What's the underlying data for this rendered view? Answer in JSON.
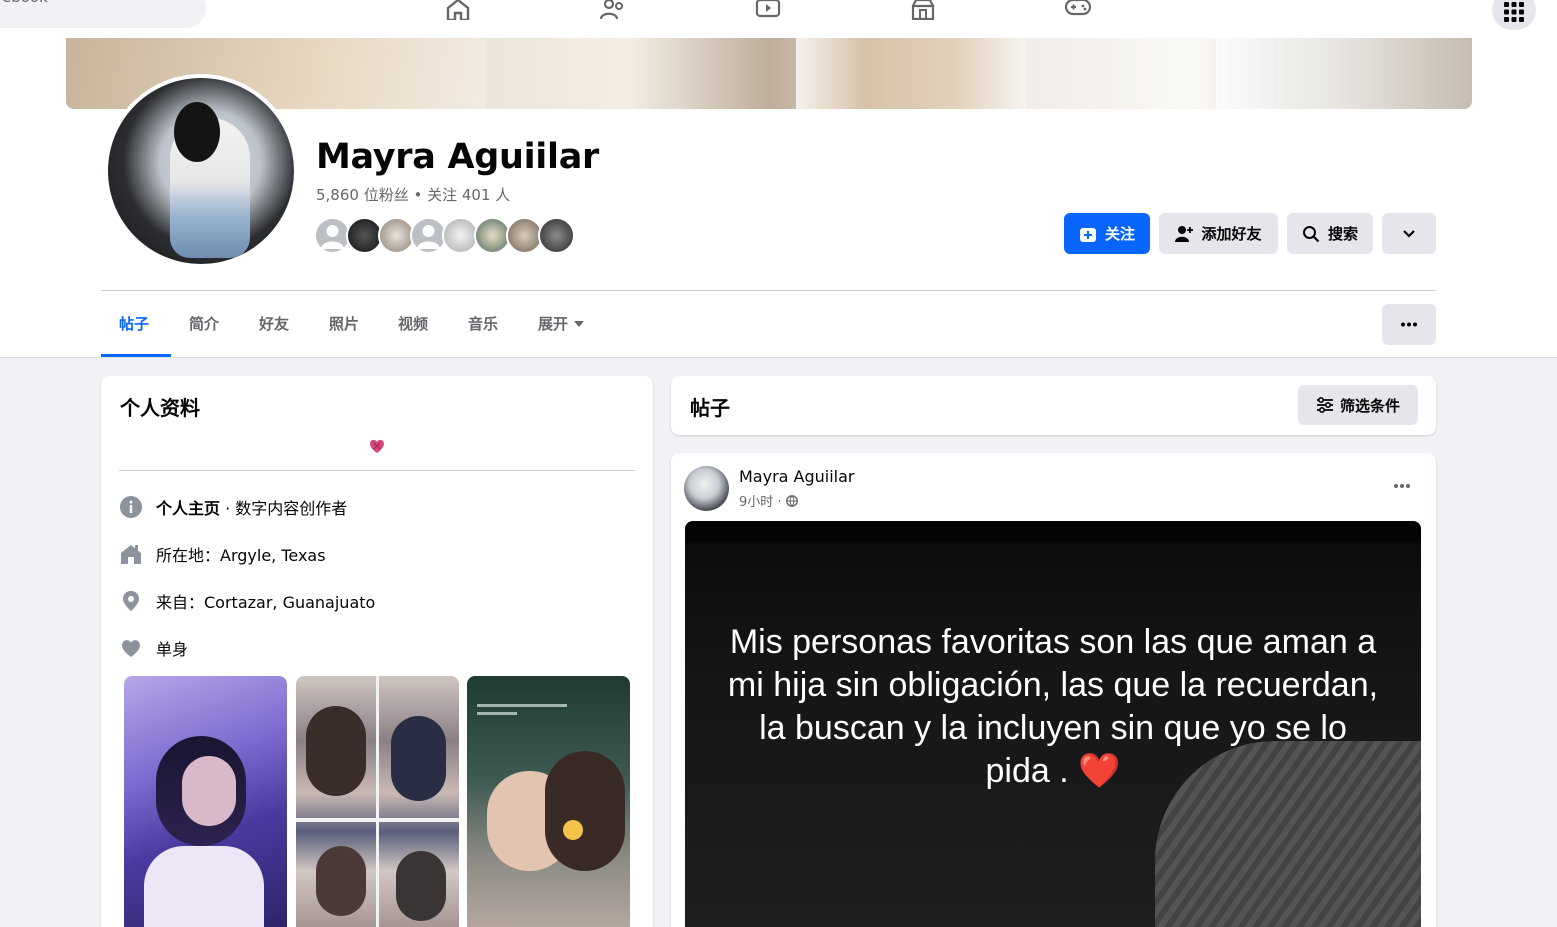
{
  "topnav": {
    "search_text": "ebook",
    "icons": [
      "home-icon",
      "friends-icon",
      "video-icon",
      "marketplace-icon",
      "gaming-icon"
    ],
    "apps_icon": "grid-menu-icon"
  },
  "profile": {
    "name": "Mayra Aguiilar",
    "stats": "5,860 位粉丝 • 关注 401 人",
    "buttons": {
      "follow": "关注",
      "add_friend": "添加好友",
      "search": "搜索"
    }
  },
  "tabs": [
    {
      "label": "帖子",
      "active": true
    },
    {
      "label": "简介"
    },
    {
      "label": "好友"
    },
    {
      "label": "照片"
    },
    {
      "label": "视频"
    },
    {
      "label": "音乐"
    },
    {
      "label": "展开"
    }
  ],
  "intro": {
    "title": "个人资料",
    "rows": [
      {
        "icon": "info-icon",
        "label_bold": "个人主页",
        "label": " · 数字内容创作者"
      },
      {
        "icon": "home-icon",
        "label": "所在地：Argyle, Texas"
      },
      {
        "icon": "location-pin-icon",
        "label": "来自：Cortazar, Guanajuato"
      },
      {
        "icon": "heart-icon",
        "label": "单身"
      }
    ]
  },
  "posts_header": {
    "title": "帖子",
    "filter_label": "筛选条件"
  },
  "post": {
    "author": "Mayra Aguiilar",
    "time": "9小时 ·",
    "quote": "Mis personas favoritas son las que aman a mi hija sin obligación, las que la recuerdan, la buscan y la incluyen sin que yo se lo pida . ❤️"
  },
  "colors": {
    "accent": "#0866ff",
    "secondary_button": "#e4e6eb",
    "page_bg": "#f0f2f5",
    "muted_text": "#65676b"
  }
}
